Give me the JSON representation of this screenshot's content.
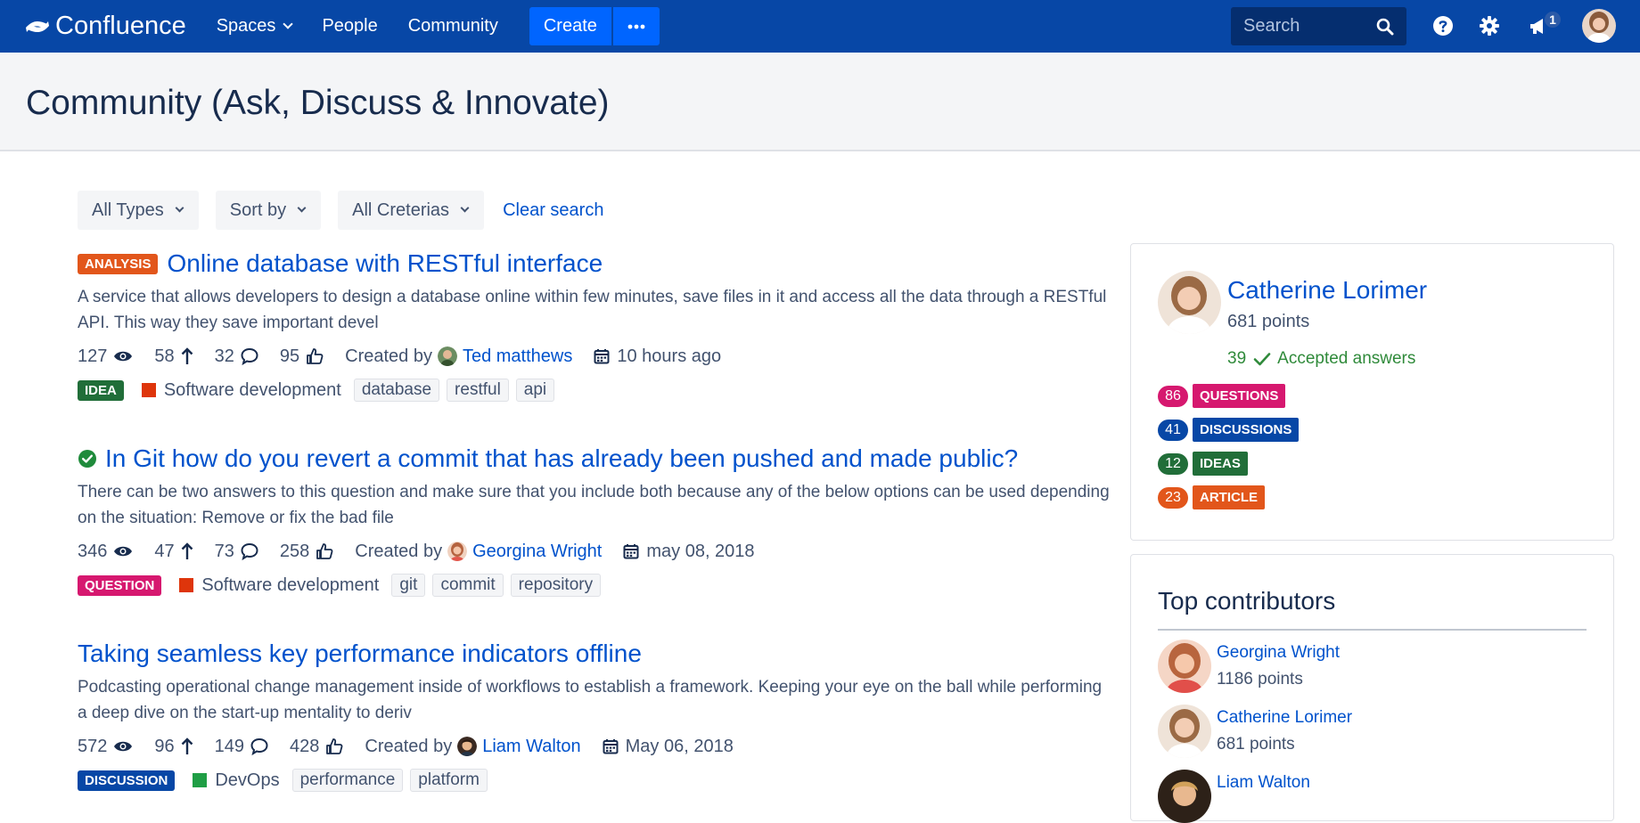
{
  "nav": {
    "brand": "Confluence",
    "spaces": "Spaces",
    "people": "People",
    "community": "Community",
    "create": "Create",
    "search_placeholder": "Search",
    "notifications_count": "1"
  },
  "page": {
    "title": "Community (Ask, Discuss & Innovate)"
  },
  "filters": {
    "types": "All Types",
    "sort": "Sort by",
    "criteria": "All Creterias",
    "clear": "Clear search"
  },
  "posts": [
    {
      "badge": "ANALYSIS",
      "badge_color": "#e2561b",
      "title": "Online database with RESTful interface",
      "description": "A service that allows developers to design a database online within few minutes, save files in it and access all the data through a RESTful API. This way they save important devel",
      "views": "127",
      "votes": "58",
      "comments": "32",
      "likes": "95",
      "created_by_label": "Created by",
      "author": "Ted matthews",
      "date": "10 hours ago",
      "type": "IDEA",
      "type_color": "#216e39",
      "category": "Software development",
      "category_color": "#de350b",
      "tags": [
        "database",
        "restful",
        "api"
      ]
    },
    {
      "title": "In Git how do you revert a commit that has already been pushed and made public?",
      "description": "There can be two answers to this question and make sure that you include both because any of the below options can be used depending on the situation: Remove or fix the bad file",
      "views": "346",
      "votes": "47",
      "comments": "73",
      "likes": "258",
      "created_by_label": "Created by",
      "author": "Georgina Wright",
      "date": "may 08, 2018",
      "type": "QUESTION",
      "type_color": "#d6186f",
      "category": "Software development",
      "category_color": "#de350b",
      "tags": [
        "git",
        "commit",
        "repository"
      ]
    },
    {
      "title": "Taking seamless key performance indicators offline",
      "description": "Podcasting operational change management inside of workflows to establish a framework. Keeping your eye on the ball while performing a deep dive on the start-up mentality to deriv",
      "views": "572",
      "votes": "96",
      "comments": "149",
      "likes": "428",
      "created_by_label": "Created by",
      "author": "Liam Walton",
      "date": "May 06, 2018",
      "type": "DISCUSSION",
      "type_color": "#0747a6",
      "category": "DevOps",
      "category_color": "#1f9e45",
      "tags": [
        "performance",
        "platform"
      ]
    }
  ],
  "profile": {
    "name": "Catherine Lorimer",
    "points": "681 points",
    "accepted_count": "39",
    "accepted_label": "Accepted answers",
    "counts": [
      {
        "count": "86",
        "label": "QUESTIONS",
        "color": "#d6186f"
      },
      {
        "count": "41",
        "label": "DISCUSSIONS",
        "color": "#0747a6"
      },
      {
        "count": "12",
        "label": "IDEAS",
        "color": "#216e39"
      },
      {
        "count": "23",
        "label": "ARTICLE",
        "color": "#e2561b"
      }
    ]
  },
  "contributors": {
    "title": "Top contributors",
    "items": [
      {
        "name": "Georgina Wright",
        "points": "1186 points"
      },
      {
        "name": "Catherine Lorimer",
        "points": "681 points"
      },
      {
        "name": "Liam Walton",
        "points": ""
      }
    ]
  }
}
